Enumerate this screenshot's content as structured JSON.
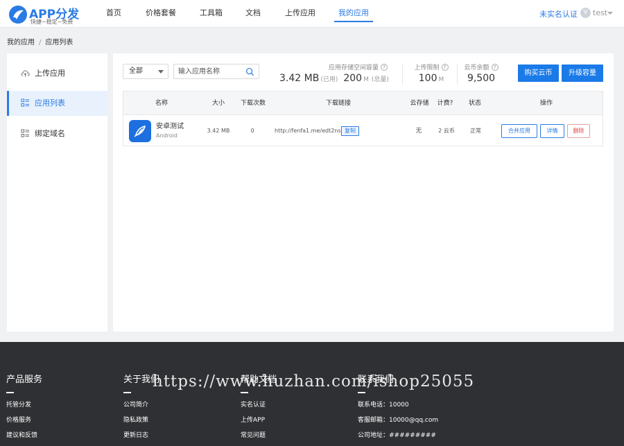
{
  "header": {
    "logo_title": "APP分发",
    "logo_subtitle": "快捷~稳定~免费",
    "nav": [
      "首页",
      "价格套餐",
      "工具箱",
      "文档",
      "上传应用",
      "我的应用"
    ],
    "active_nav": "我的应用",
    "realname_link": "未实名认证",
    "user_avatar_letter": "V",
    "username": "test",
    "accent_color": "#2a7be4"
  },
  "breadcrumb": {
    "root": "我的应用",
    "separator": "/",
    "current": "应用列表"
  },
  "sidebar": {
    "items": [
      {
        "label": "上传应用",
        "icon": "cloud-upload-icon"
      },
      {
        "label": "应用列表",
        "icon": "grid-list-icon",
        "active": true
      },
      {
        "label": "绑定域名",
        "icon": "grid-list-icon"
      }
    ]
  },
  "toolbar": {
    "filter_value": "全部",
    "search_placeholder": "输入应用名称"
  },
  "stats": {
    "storage_label": "应用存储空间容量",
    "storage_used": "3.42 MB",
    "storage_used_unit": "(已用)",
    "storage_total": "200",
    "storage_total_unit": "M",
    "storage_total_suffix": "(总量)",
    "upload_limit_label": "上传限制",
    "upload_limit_value": "100",
    "upload_limit_unit": "M",
    "coins_label": "云币余额",
    "coins_value": "9,500",
    "question_mark": "?"
  },
  "buttons": {
    "buy_coins": "购买云币",
    "upgrade_storage": "升级容量"
  },
  "table": {
    "headers": [
      "名称",
      "大小",
      "下载次数",
      "下载链接",
      "云存储",
      "计费?",
      "状态",
      "操作"
    ],
    "rows": [
      {
        "name": "安卓测试",
        "platform": "Android",
        "size": "3.42 MB",
        "downloads": "0",
        "link": "http://fenfa1.me/edt2ns",
        "copy_label": "复制",
        "cloud_storage": "无",
        "billing": "2 云币",
        "status": "正常",
        "actions": [
          "合并应用",
          "详情",
          "删除"
        ]
      }
    ]
  },
  "footer": {
    "columns": [
      {
        "title": "产品服务",
        "links": [
          "托管分发",
          "价格服务",
          "建议和反馈"
        ]
      },
      {
        "title": "关于我们",
        "links": [
          "公司简介",
          "隐私政策",
          "更新日志"
        ]
      },
      {
        "title": "帮助文档",
        "links": [
          "实名认证",
          "上传APP",
          "常见问题"
        ]
      },
      {
        "title": "联系我们",
        "links": [
          "联系电话：10000",
          "客服邮箱：10000@qq.com",
          "公司地址：#########"
        ]
      }
    ],
    "watermark": "https://www.huzhan.com/ishop25055"
  }
}
